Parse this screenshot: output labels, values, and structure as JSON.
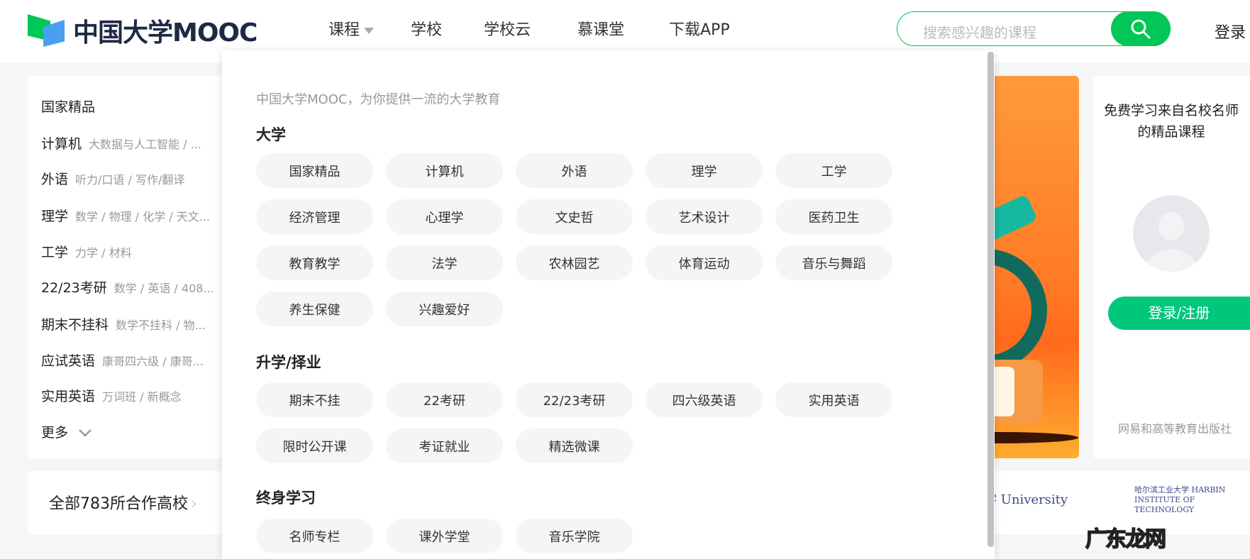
{
  "header": {
    "logo_text": "中国大学MOOC",
    "nav": [
      {
        "label": "课程"
      },
      {
        "label": "学校"
      },
      {
        "label": "学校云"
      },
      {
        "label": "慕课堂"
      },
      {
        "label": "下载APP"
      }
    ],
    "search_placeholder": "搜索感兴趣的课程",
    "login": "登录"
  },
  "left_panel": {
    "categories": [
      {
        "label": "国家精品",
        "sub": ""
      },
      {
        "label": "计算机",
        "sub": "大数据与人工智能 / ..."
      },
      {
        "label": "外语",
        "sub": "听力/口语 / 写作/翻译"
      },
      {
        "label": "理学",
        "sub": "数学 / 物理 / 化学 / 天文..."
      },
      {
        "label": "工学",
        "sub": "力学 / 材料"
      },
      {
        "label": "22/23考研",
        "sub": "数学 / 英语 / 408..."
      },
      {
        "label": "期末不挂科",
        "sub": "数学不挂科 / 物..."
      },
      {
        "label": "应试英语",
        "sub": "康哥四六级 / 康哥..."
      },
      {
        "label": "实用英语",
        "sub": "万词班 / 新概念"
      }
    ],
    "more": "更多"
  },
  "dropdown": {
    "subtitle": "中国大学MOOC，为你提供一流的大学教育",
    "sections": [
      {
        "title": "大学",
        "items": [
          "国家精品",
          "计算机",
          "外语",
          "理学",
          "工学",
          "经济管理",
          "心理学",
          "文史哲",
          "艺术设计",
          "医药卫生",
          "教育教学",
          "法学",
          "农林园艺",
          "体育运动",
          "音乐与舞蹈",
          "养生保健",
          "兴趣爱好"
        ]
      },
      {
        "title": "升学/择业",
        "items": [
          "期末不挂",
          "22考研",
          "22/23考研",
          "四六级英语",
          "实用英语",
          "限时公开课",
          "考证就业",
          "精选微课"
        ]
      },
      {
        "title": "终身学习",
        "items": [
          "名师专栏",
          "课外学堂",
          "音乐学院"
        ]
      }
    ]
  },
  "right_card": {
    "title": "免费学习来自名校名师的精品课程",
    "button": "登录/注册",
    "footer": "网易和高等教育出版社"
  },
  "strip": {
    "partners": "全部783所合作高校",
    "uni1": "大学 University",
    "uni2": "哈尔滨工业大学 HARBIN INSTITUTE OF TECHNOLOGY"
  },
  "watermark": "广东龙网",
  "colors": {
    "brand_green": "#00c758",
    "button_green": "#00c77b"
  }
}
